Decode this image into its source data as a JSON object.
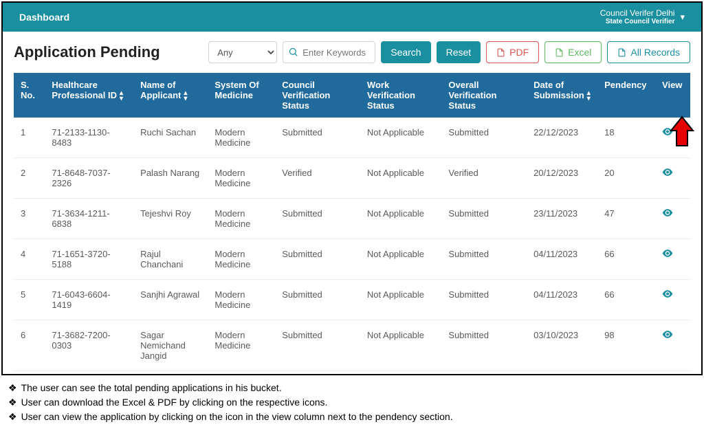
{
  "header": {
    "dashboard": "Dashboard",
    "user_name": "Council Verifer Delhi",
    "user_role": "State Council Verifier"
  },
  "page": {
    "title": "Application Pending",
    "filter_any": "Any",
    "search_placeholder": "Enter Keywords",
    "search_btn": "Search",
    "reset_btn": "Reset",
    "pdf_btn": "PDF",
    "excel_btn": "Excel",
    "all_btn": "All Records"
  },
  "table": {
    "headers": {
      "sno": "S. No.",
      "hpid": "Healthcare Professional ID",
      "name": "Name of Applicant",
      "system": "System Of Medicine",
      "council": "Council Verification Status",
      "work": "Work Verification Status",
      "overall": "Overall Verification Status",
      "date": "Date of Submission",
      "pendency": "Pendency",
      "view": "View"
    },
    "rows": [
      {
        "sno": "1",
        "hpid": "71-2133-1130-8483",
        "name": "Ruchi Sachan",
        "system": "Modern Medicine",
        "council": "Submitted",
        "work": "Not Applicable",
        "overall": "Submitted",
        "date": "22/12/2023",
        "pendency": "18"
      },
      {
        "sno": "2",
        "hpid": "71-8648-7037-2326",
        "name": "Palash Narang",
        "system": "Modern Medicine",
        "council": "Verified",
        "work": "Not Applicable",
        "overall": "Verified",
        "date": "20/12/2023",
        "pendency": "20"
      },
      {
        "sno": "3",
        "hpid": "71-3634-1211-6838",
        "name": "Tejeshvi Roy",
        "system": "Modern Medicine",
        "council": "Submitted",
        "work": "Not Applicable",
        "overall": "Submitted",
        "date": "23/11/2023",
        "pendency": "47"
      },
      {
        "sno": "4",
        "hpid": "71-1651-3720-5188",
        "name": "Rajul Chanchani",
        "system": "Modern Medicine",
        "council": "Submitted",
        "work": "Not Applicable",
        "overall": "Submitted",
        "date": "04/11/2023",
        "pendency": "66"
      },
      {
        "sno": "5",
        "hpid": "71-6043-6604-1419",
        "name": "Sanjhi Agrawal",
        "system": "Modern Medicine",
        "council": "Submitted",
        "work": "Not Applicable",
        "overall": "Submitted",
        "date": "04/11/2023",
        "pendency": "66"
      },
      {
        "sno": "6",
        "hpid": "71-3682-7200-0303",
        "name": "Sagar Nemichand Jangid",
        "system": "Modern Medicine",
        "council": "Submitted",
        "work": "Not Applicable",
        "overall": "Submitted",
        "date": "03/10/2023",
        "pendency": "98"
      }
    ]
  },
  "notes": [
    "The user can see the total pending applications in his bucket.",
    "User can download the Excel & PDF by clicking on the respective icons.",
    "User can view the application by clicking on the icon in the view column next to the pendency section."
  ]
}
